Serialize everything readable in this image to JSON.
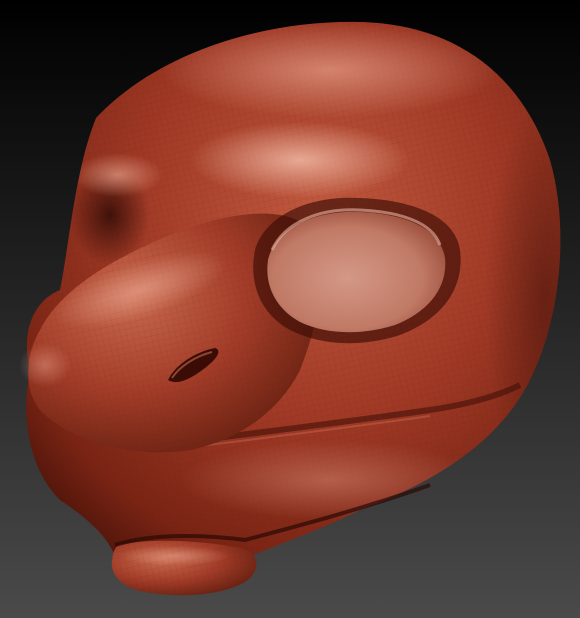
{
  "scene": {
    "subject": "sculpted-creature-head",
    "colors": {
      "bg_top": "#000000",
      "bg_bottom": "#4a4a4a",
      "clay_base": "#a13a26",
      "clay_light": "#d8826c",
      "clay_mid": "#b84e36",
      "clay_shadow": "#4a1208",
      "clay_deep": "#2a0904",
      "eye_socket_light": "#d69a88",
      "eye_socket_mid": "#b86a58",
      "mesh_line": "#5a1a0e"
    }
  }
}
